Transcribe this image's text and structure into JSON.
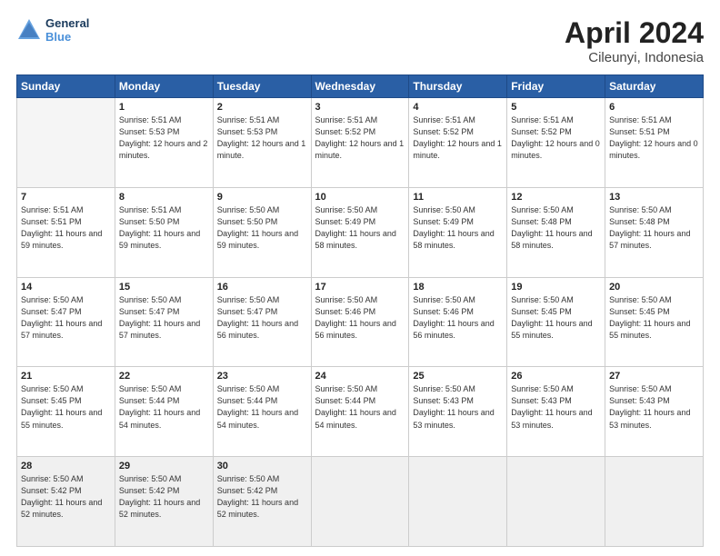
{
  "header": {
    "logo_line1": "General",
    "logo_line2": "Blue",
    "month_year": "April 2024",
    "location": "Cileunyi, Indonesia"
  },
  "days_of_week": [
    "Sunday",
    "Monday",
    "Tuesday",
    "Wednesday",
    "Thursday",
    "Friday",
    "Saturday"
  ],
  "weeks": [
    [
      {
        "day": "",
        "empty": true
      },
      {
        "day": "1",
        "sunrise": "5:51 AM",
        "sunset": "5:53 PM",
        "daylight": "12 hours and 2 minutes."
      },
      {
        "day": "2",
        "sunrise": "5:51 AM",
        "sunset": "5:53 PM",
        "daylight": "12 hours and 1 minute."
      },
      {
        "day": "3",
        "sunrise": "5:51 AM",
        "sunset": "5:52 PM",
        "daylight": "12 hours and 1 minute."
      },
      {
        "day": "4",
        "sunrise": "5:51 AM",
        "sunset": "5:52 PM",
        "daylight": "12 hours and 1 minute."
      },
      {
        "day": "5",
        "sunrise": "5:51 AM",
        "sunset": "5:52 PM",
        "daylight": "12 hours and 0 minutes."
      },
      {
        "day": "6",
        "sunrise": "5:51 AM",
        "sunset": "5:51 PM",
        "daylight": "12 hours and 0 minutes."
      }
    ],
    [
      {
        "day": "7",
        "sunrise": "5:51 AM",
        "sunset": "5:51 PM",
        "daylight": "11 hours and 59 minutes."
      },
      {
        "day": "8",
        "sunrise": "5:51 AM",
        "sunset": "5:50 PM",
        "daylight": "11 hours and 59 minutes."
      },
      {
        "day": "9",
        "sunrise": "5:50 AM",
        "sunset": "5:50 PM",
        "daylight": "11 hours and 59 minutes."
      },
      {
        "day": "10",
        "sunrise": "5:50 AM",
        "sunset": "5:49 PM",
        "daylight": "11 hours and 58 minutes."
      },
      {
        "day": "11",
        "sunrise": "5:50 AM",
        "sunset": "5:49 PM",
        "daylight": "11 hours and 58 minutes."
      },
      {
        "day": "12",
        "sunrise": "5:50 AM",
        "sunset": "5:48 PM",
        "daylight": "11 hours and 58 minutes."
      },
      {
        "day": "13",
        "sunrise": "5:50 AM",
        "sunset": "5:48 PM",
        "daylight": "11 hours and 57 minutes."
      }
    ],
    [
      {
        "day": "14",
        "sunrise": "5:50 AM",
        "sunset": "5:47 PM",
        "daylight": "11 hours and 57 minutes."
      },
      {
        "day": "15",
        "sunrise": "5:50 AM",
        "sunset": "5:47 PM",
        "daylight": "11 hours and 57 minutes."
      },
      {
        "day": "16",
        "sunrise": "5:50 AM",
        "sunset": "5:47 PM",
        "daylight": "11 hours and 56 minutes."
      },
      {
        "day": "17",
        "sunrise": "5:50 AM",
        "sunset": "5:46 PM",
        "daylight": "11 hours and 56 minutes."
      },
      {
        "day": "18",
        "sunrise": "5:50 AM",
        "sunset": "5:46 PM",
        "daylight": "11 hours and 56 minutes."
      },
      {
        "day": "19",
        "sunrise": "5:50 AM",
        "sunset": "5:45 PM",
        "daylight": "11 hours and 55 minutes."
      },
      {
        "day": "20",
        "sunrise": "5:50 AM",
        "sunset": "5:45 PM",
        "daylight": "11 hours and 55 minutes."
      }
    ],
    [
      {
        "day": "21",
        "sunrise": "5:50 AM",
        "sunset": "5:45 PM",
        "daylight": "11 hours and 55 minutes."
      },
      {
        "day": "22",
        "sunrise": "5:50 AM",
        "sunset": "5:44 PM",
        "daylight": "11 hours and 54 minutes."
      },
      {
        "day": "23",
        "sunrise": "5:50 AM",
        "sunset": "5:44 PM",
        "daylight": "11 hours and 54 minutes."
      },
      {
        "day": "24",
        "sunrise": "5:50 AM",
        "sunset": "5:44 PM",
        "daylight": "11 hours and 54 minutes."
      },
      {
        "day": "25",
        "sunrise": "5:50 AM",
        "sunset": "5:43 PM",
        "daylight": "11 hours and 53 minutes."
      },
      {
        "day": "26",
        "sunrise": "5:50 AM",
        "sunset": "5:43 PM",
        "daylight": "11 hours and 53 minutes."
      },
      {
        "day": "27",
        "sunrise": "5:50 AM",
        "sunset": "5:43 PM",
        "daylight": "11 hours and 53 minutes."
      }
    ],
    [
      {
        "day": "28",
        "sunrise": "5:50 AM",
        "sunset": "5:42 PM",
        "daylight": "11 hours and 52 minutes.",
        "last": true
      },
      {
        "day": "29",
        "sunrise": "5:50 AM",
        "sunset": "5:42 PM",
        "daylight": "11 hours and 52 minutes.",
        "last": true
      },
      {
        "day": "30",
        "sunrise": "5:50 AM",
        "sunset": "5:42 PM",
        "daylight": "11 hours and 52 minutes.",
        "last": true
      },
      {
        "day": "",
        "empty": true,
        "last": true
      },
      {
        "day": "",
        "empty": true,
        "last": true
      },
      {
        "day": "",
        "empty": true,
        "last": true
      },
      {
        "day": "",
        "empty": true,
        "last": true
      }
    ]
  ],
  "labels": {
    "sunrise": "Sunrise:",
    "sunset": "Sunset:",
    "daylight": "Daylight:"
  }
}
